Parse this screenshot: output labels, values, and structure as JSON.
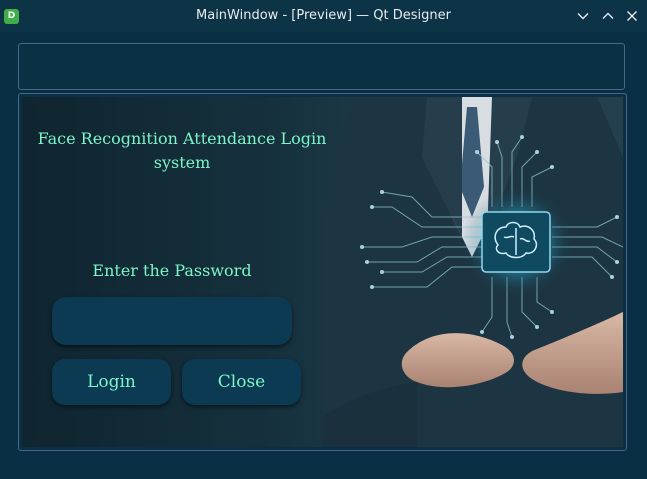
{
  "window": {
    "app_icon_letter": "D",
    "title": "MainWindow - [Preview] — Qt Designer",
    "controls": [
      "minimize-icon",
      "maximize-icon",
      "close-icon"
    ]
  },
  "login": {
    "heading": "Face Recognition Attendance Login system",
    "password_label": "Enter the Password",
    "password_value": "",
    "login_label": "Login",
    "close_label": "Close"
  },
  "colors": {
    "text_accent": "#7df5c8",
    "button_bg": "#0b3a52",
    "window_bg": "#0a2f44",
    "titlebar_bg": "#0d3346"
  }
}
